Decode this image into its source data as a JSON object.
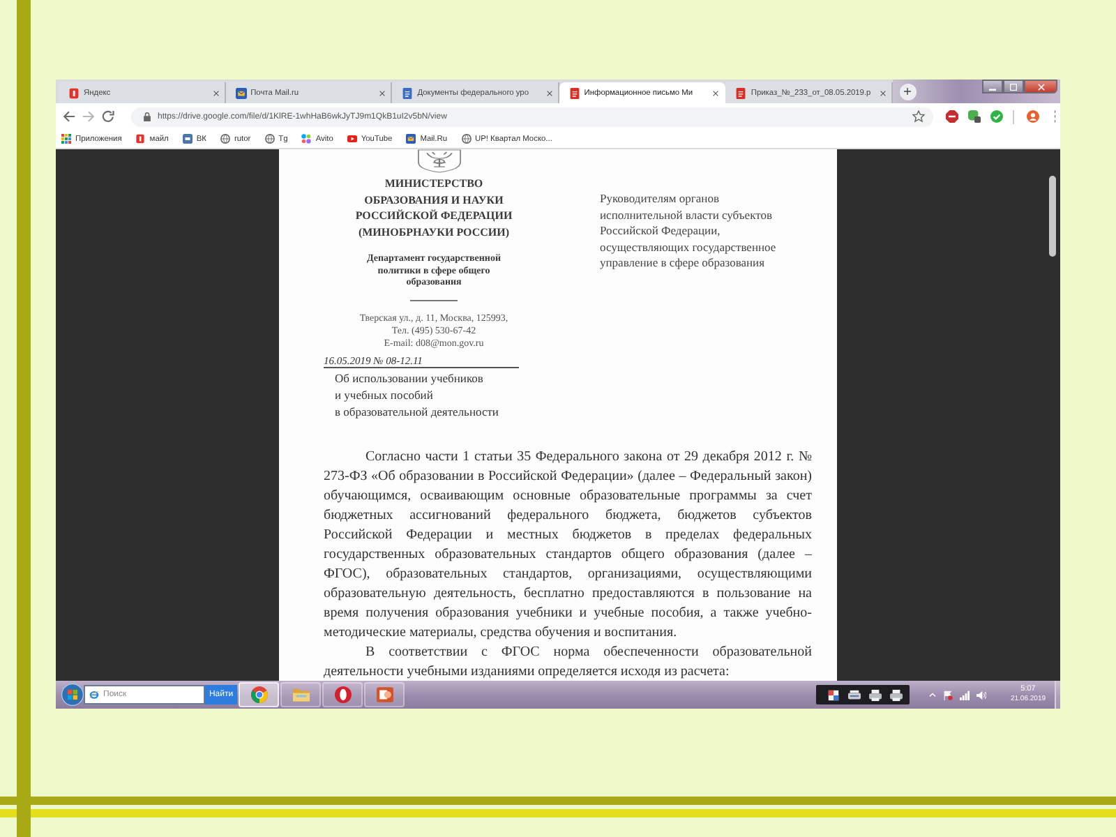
{
  "tabs": [
    {
      "title": "Яндекс",
      "selected": false
    },
    {
      "title": "Почта Mail.ru",
      "selected": false
    },
    {
      "title": "Документы федерального уро",
      "selected": false
    },
    {
      "title": "Информационное письмо Ми",
      "selected": true
    },
    {
      "title": "Приказ_№_233_от_08.05.2019.p",
      "selected": false
    }
  ],
  "address_bar": {
    "url": "https://drive.google.com/file/d/1KlRE-1whHaB6wkJyTJ9m1QkB1uI2v5bN/view"
  },
  "bookmarks": [
    "Приложения",
    "майл",
    "ВК",
    "rutor",
    "Tg",
    "Avito",
    "YouTube",
    "Mail.Ru",
    "UP! Квартал Моско..."
  ],
  "document": {
    "ministry": "МИНИСТЕРСТВО\nОБРАЗОВАНИЯ И НАУКИ\nРОССИЙСКОЙ ФЕДЕРАЦИИ\n(МИНОБРНАУКИ РОССИИ)",
    "department": "Департамент государственной\nполитики в сфере общего\nобразования",
    "address": "Тверская ул., д. 11, Москва, 125993,\nТел. (495) 530-67-42\nE-mail: d08@mon.gov.ru",
    "date_number": "16.05.2019 № 08-12.11",
    "subject": "Об использовании учебников\nи учебных пособий\nв образовательной деятельности",
    "addressee": "Руководителям органов\nисполнительной власти субъектов\nРоссийской Федерации,\nосуществляющих государственное\nуправление в сфере образования",
    "paragraphs": [
      "Согласно части 1 статьи 35 Федерального закона от 29 декабря 2012 г. № 273-ФЗ «Об образовании в Российской Федерации» (далее – Федеральный закон) обучающимся, осваивающим основные образовательные программы за счет бюджетных ассигнований федерального бюджета, бюджетов субъектов Российской Федерации и местных бюджетов в пределах федеральных государственных образовательных стандартов общего образования (далее – ФГОС), образовательных стандартов, организациями, осуществляющими образовательную деятельность, бесплатно предоставляются в пользование на время получения образования учебники и учебные пособия, а также учебно-методические материалы, средства обучения и воспитания.",
      "В соответствии с ФГОС норма обеспеченности образовательной деятельности учебными изданиями определяется исходя из расчета:"
    ]
  },
  "taskbar": {
    "search": {
      "placeholder": "Поиск"
    },
    "search_button": "Найти",
    "clock": {
      "time": "5:07",
      "date": "21.06.2019"
    }
  }
}
